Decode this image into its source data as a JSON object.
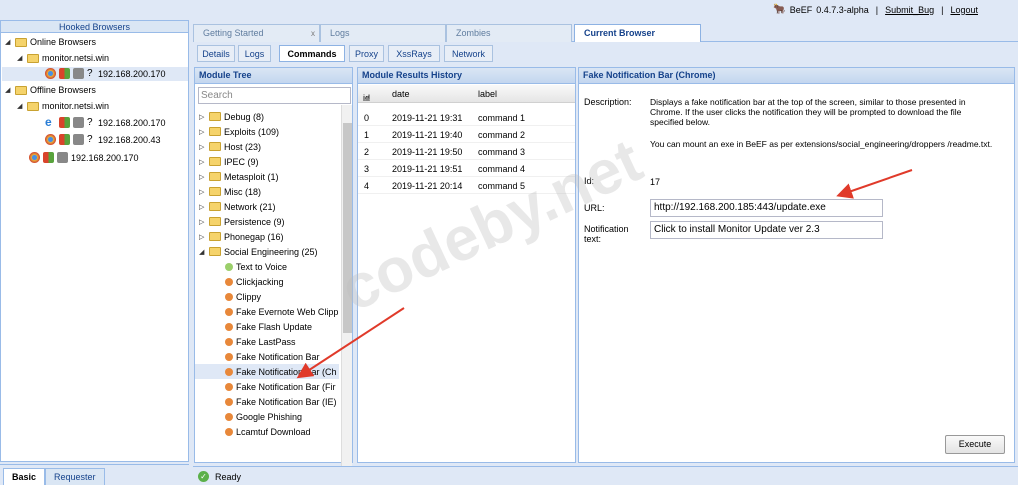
{
  "header": {
    "app_name": "BeEF",
    "version": "0.4.7.3-alpha",
    "separator": "|",
    "submit_bug": "Submit_Bug",
    "logout": "Logout"
  },
  "hooked": {
    "title": "Hooked Browsers",
    "online_label": "Online Browsers",
    "online_host": "monitor.netsi.win",
    "online_ip": "192.168.200.170",
    "offline_label": "Offline Browsers",
    "offline_host": "monitor.netsi.win",
    "offline_ips": [
      "192.168.200.170",
      "192.168.200.43",
      "192.168.200.170"
    ],
    "unknown_mark": "?"
  },
  "left_tabs": [
    "Basic",
    "Requester"
  ],
  "main_tabs": [
    "Getting Started",
    "Logs",
    "Zombies",
    "Current Browser"
  ],
  "close_glyph": "x",
  "sub_tabs": [
    "Details",
    "Logs",
    "Commands",
    "Proxy",
    "XssRays",
    "Network"
  ],
  "module_tree": {
    "title": "Module Tree",
    "search_placeholder": "Search",
    "folders": [
      "Debug (8)",
      "Exploits (109)",
      "Host (23)",
      "IPEC (9)",
      "Metasploit (1)",
      "Misc (18)",
      "Network (21)",
      "Persistence (9)",
      "Phonegap (16)",
      "Social Engineering (25)"
    ],
    "modules": [
      "Text to Voice",
      "Clickjacking",
      "Clippy",
      "Fake Evernote Web Clipp",
      "Fake Flash Update",
      "Fake LastPass",
      "Fake Notification Bar",
      "Fake Notification Bar (Ch",
      "Fake Notification Bar (Fir",
      "Fake Notification Bar (IE)",
      "Google Phishing",
      "Lcamtuf Download"
    ]
  },
  "results": {
    "title": "Module Results History",
    "columns": [
      "id",
      "date",
      "label"
    ],
    "sort_arrow": "▲",
    "rows": [
      {
        "id": "0",
        "date": "2019-11-21 19:31",
        "label": "command 1"
      },
      {
        "id": "1",
        "date": "2019-11-21 19:40",
        "label": "command 2"
      },
      {
        "id": "2",
        "date": "2019-11-21 19:50",
        "label": "command 3"
      },
      {
        "id": "3",
        "date": "2019-11-21 19:51",
        "label": "command 4"
      },
      {
        "id": "4",
        "date": "2019-11-21 20:14",
        "label": "command 5"
      }
    ]
  },
  "details": {
    "title": "Fake Notification Bar (Chrome)",
    "description_label": "Description:",
    "description": "Displays a fake notification bar at the top of the screen, similar to those presented in Chrome. If the user clicks the notification they will be prompted to download the file specified below.",
    "description_note": "You can mount an exe in BeEF as per extensions/social_engineering/droppers /readme.txt.",
    "id_label": "Id:",
    "id_value": "17",
    "url_label": "URL:",
    "url_value": "http://192.168.200.185:443/update.exe",
    "notification_label": "Notification text:",
    "notification_value": "Click to install Monitor Update ver 2.3",
    "execute": "Execute"
  },
  "status": {
    "text": "Ready",
    "check": "✓"
  },
  "watermark": "codeby.net",
  "colors": {
    "accent": "#15428b",
    "arrow": "#e03a2a",
    "panel_bg": "#dfe8f6"
  }
}
